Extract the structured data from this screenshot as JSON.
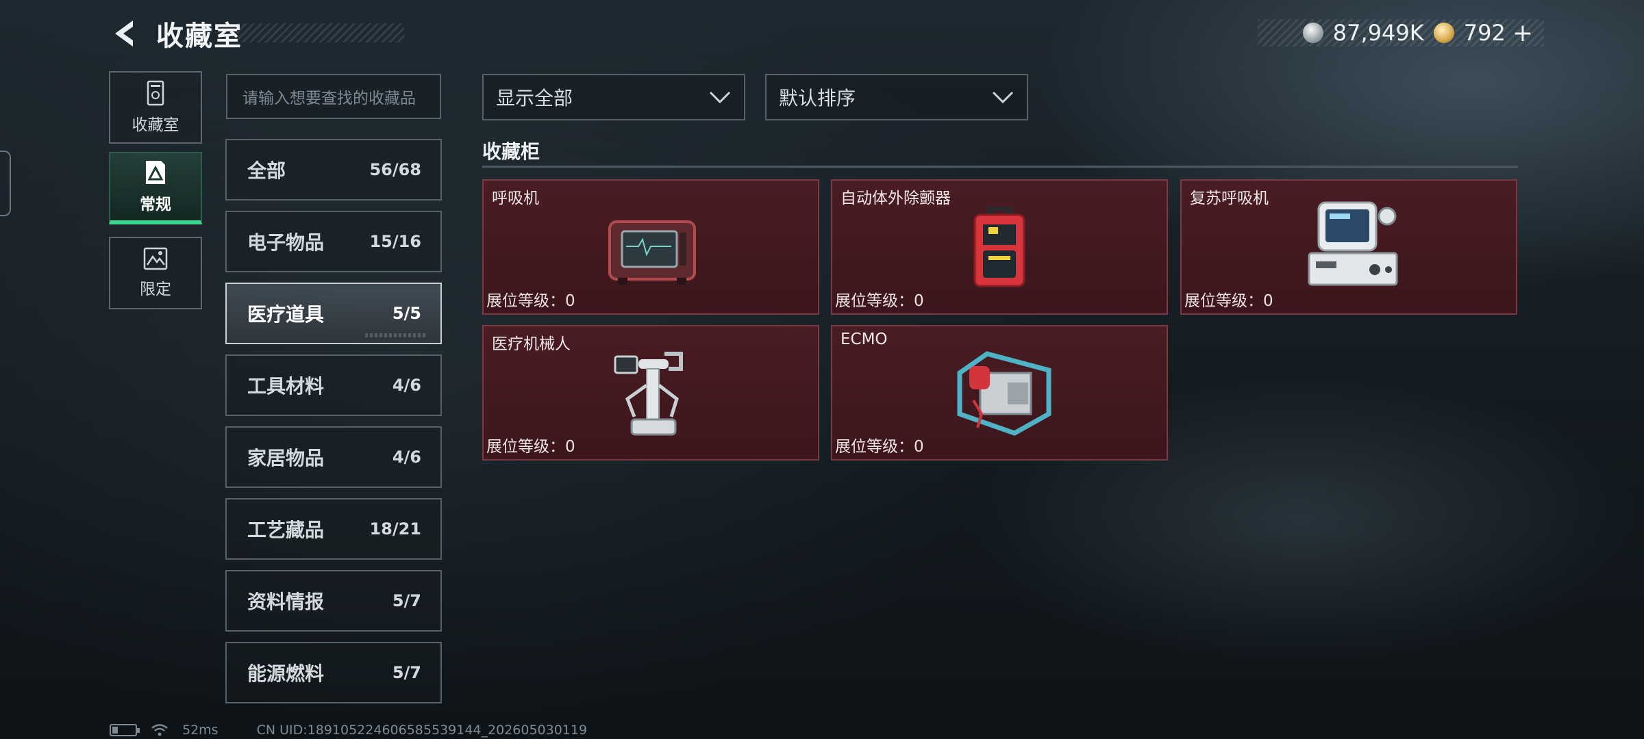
{
  "header": {
    "title": "收藏室",
    "currency": [
      {
        "icon": "silver-coin-icon",
        "value": "87,949K"
      },
      {
        "icon": "gold-coin-icon",
        "value": "792"
      }
    ],
    "add_label": "+"
  },
  "rail": {
    "tabs": [
      {
        "label": "收藏室",
        "icon": "cabinet-icon",
        "active": false
      },
      {
        "label": "常规",
        "icon": "warning-card-icon",
        "active": true
      },
      {
        "label": "限定",
        "icon": "landscape-icon",
        "active": false
      }
    ]
  },
  "search": {
    "placeholder": "请输入想要查找的收藏品"
  },
  "categories": [
    {
      "name": "全部",
      "count": "56/68"
    },
    {
      "name": "电子物品",
      "count": "15/16"
    },
    {
      "name": "医疗道具",
      "count": "5/5",
      "active": true
    },
    {
      "name": "工具材料",
      "count": "4/6"
    },
    {
      "name": "家居物品",
      "count": "4/6"
    },
    {
      "name": "工艺藏品",
      "count": "18/21"
    },
    {
      "name": "资料情报",
      "count": "5/7"
    },
    {
      "name": "能源燃料",
      "count": "5/7"
    }
  ],
  "filters": {
    "display": "显示全部",
    "sort": "默认排序"
  },
  "section": {
    "title": "收藏柜"
  },
  "items": [
    {
      "name": "呼吸机",
      "level_label": "展位等级：",
      "level": "0"
    },
    {
      "name": "自动体外除颤器",
      "level_label": "展位等级：",
      "level": "0"
    },
    {
      "name": "复苏呼吸机",
      "level_label": "展位等级：",
      "level": "0"
    },
    {
      "name": "医疗机械人",
      "level_label": "展位等级：",
      "level": "0"
    },
    {
      "name": "ECMO",
      "level_label": "展位等级：",
      "level": "0"
    }
  ],
  "footer": {
    "ping": "52ms",
    "uid": "CN UID:1891052246065855391​44_202605030119"
  },
  "colors": {
    "accent_green": "#3cd592",
    "card_bg": "#4a1c23",
    "card_border": "#7a3a43"
  }
}
